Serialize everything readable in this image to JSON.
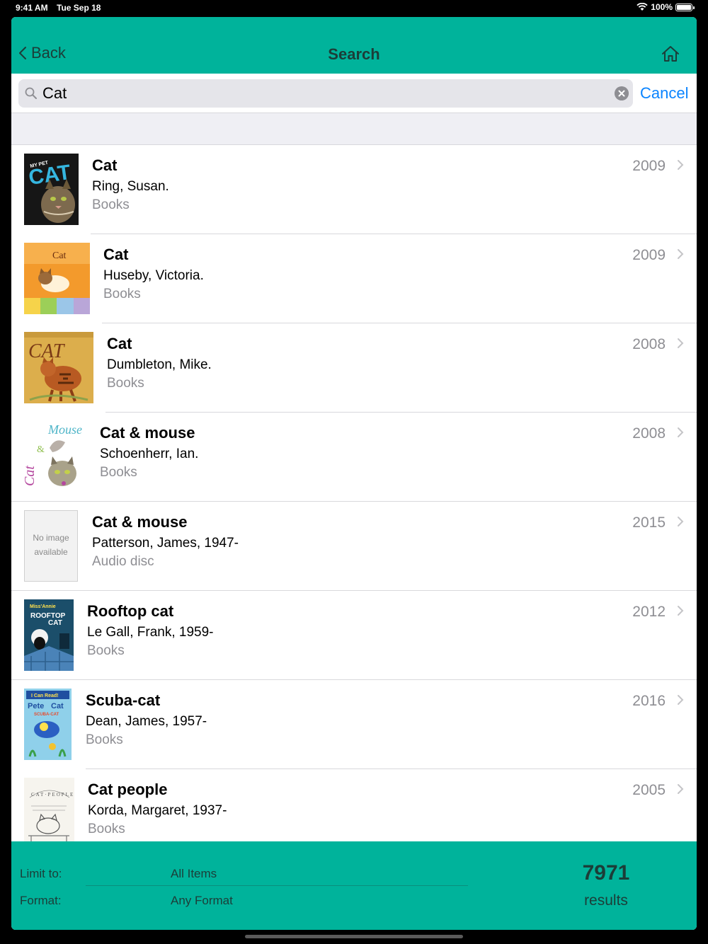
{
  "status_bar": {
    "time": "9:41 AM",
    "date": "Tue Sep 18",
    "battery": "100%"
  },
  "nav": {
    "back_label": "Back",
    "title": "Search"
  },
  "search": {
    "query": "Cat",
    "cancel_label": "Cancel"
  },
  "results": [
    {
      "title": "Cat",
      "author": "Ring, Susan.",
      "format": "Books",
      "year": "2009",
      "cover": {
        "text": "MY PET CAT",
        "color": "#1a1a1a",
        "accent": "#35b6e0"
      }
    },
    {
      "title": "Cat",
      "author": "Huseby, Victoria.",
      "format": "Books",
      "year": "2009",
      "cover": {
        "text": "Cat",
        "color": "#f08a1e",
        "accent": "#7a3b12"
      }
    },
    {
      "title": "Cat",
      "author": "Dumbleton, Mike.",
      "format": "Books",
      "year": "2008",
      "cover": {
        "text": "CAT",
        "color": "#d8a43a",
        "accent": "#7a3a16"
      }
    },
    {
      "title": "Cat & mouse",
      "author": "Schoenherr, Ian.",
      "format": "Books",
      "year": "2008",
      "cover": {
        "text": "Cat & Mouse",
        "color": "#ffffff",
        "accent": "#b4479e"
      }
    },
    {
      "title": "Cat & mouse",
      "author": "Patterson, James, 1947-",
      "format": "Audio disc",
      "year": "2015",
      "cover": {
        "text": "No image available",
        "color": "#f2f2f2",
        "accent": "#8a8a8a"
      }
    },
    {
      "title": "Rooftop cat",
      "author": "Le Gall, Frank, 1959-",
      "format": "Books",
      "year": "2012",
      "cover": {
        "text": "ROOFTOP CAT",
        "color": "#1b4e6a",
        "accent": "#ffe14d"
      }
    },
    {
      "title": "Scuba-cat",
      "author": "Dean, James, 1957-",
      "format": "Books",
      "year": "2016",
      "cover": {
        "text": "Pete the Cat",
        "color": "#7fc8e8",
        "accent": "#1f4fa0"
      }
    },
    {
      "title": "Cat people",
      "author": "Korda, Margaret, 1937-",
      "format": "Books",
      "year": "2005",
      "cover": {
        "text": "CAT PEOPLE",
        "color": "#f4f2ec",
        "accent": "#555555"
      }
    }
  ],
  "footer": {
    "limit_label": "Limit to:",
    "limit_value": "All Items",
    "format_label": "Format:",
    "format_value": "Any Format",
    "count": "7971",
    "count_label": "results"
  },
  "colors": {
    "accent": "#00b39b",
    "link": "#0a84ff",
    "secondary_text": "#8e8e93"
  }
}
